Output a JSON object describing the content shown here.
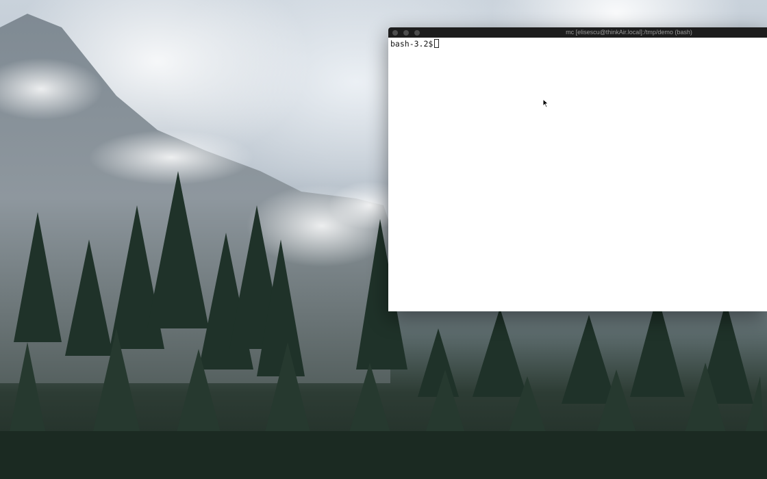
{
  "window": {
    "title": "mc [elisescu@thinkAir.local]:/tmp/demo (bash)"
  },
  "terminal": {
    "prompt": "bash-3.2$"
  },
  "icons": {
    "pointer": "mouse-pointer-icon"
  }
}
